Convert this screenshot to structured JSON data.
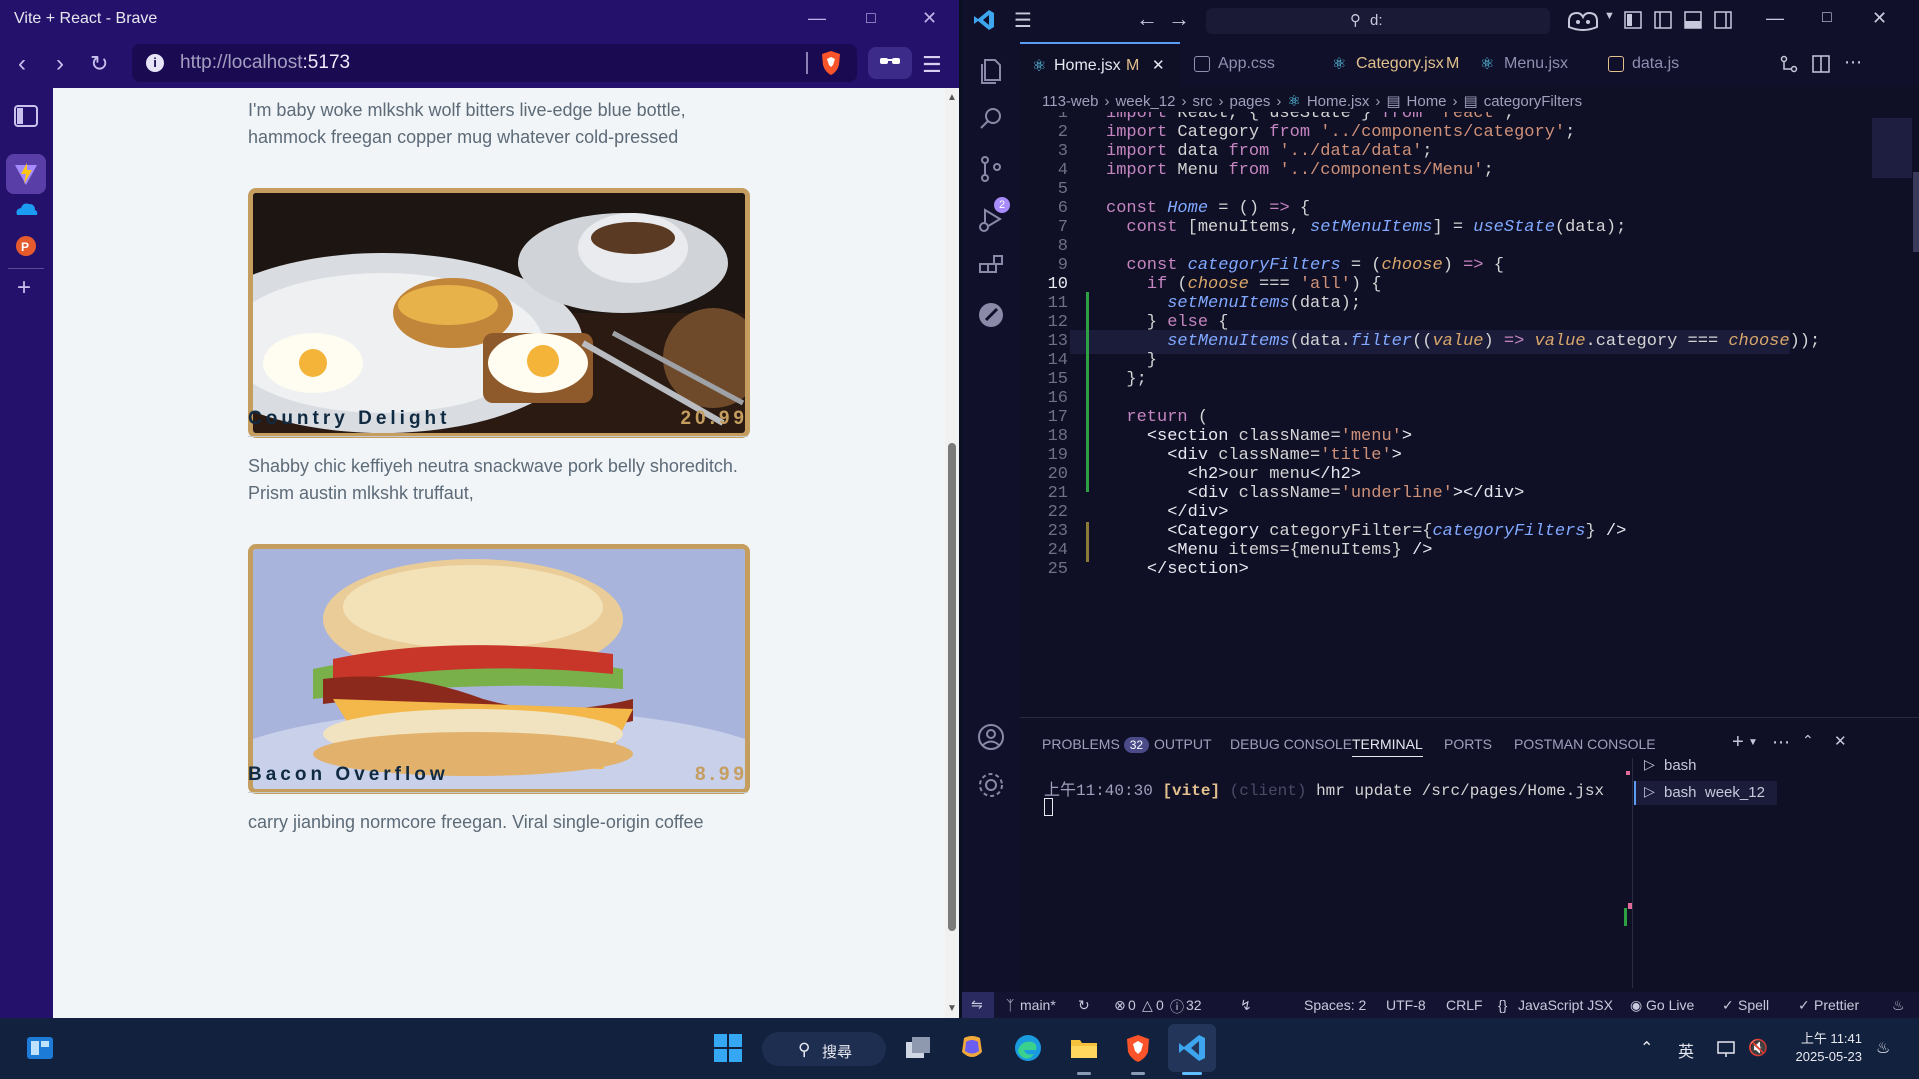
{
  "browser": {
    "window_title": "Vite + React - Brave",
    "url_host": "http://localhost",
    "url_port": ":5173",
    "nav_icons": [
      "back-icon",
      "forward-icon",
      "reload-icon"
    ]
  },
  "menu_page": {
    "intro_desc": "I'm baby woke mlkshk wolf bitters live-edge blue bottle, hammock freegan copper mug whatever cold-pressed",
    "items": [
      {
        "name": "Country Delight",
        "price": "20.99",
        "desc": "Shabby chic keffiyeh neutra snackwave pork belly shoreditch. Prism austin mlkshk truffaut,"
      },
      {
        "name": "Bacon Overflow",
        "price": "8.99",
        "desc": "carry jianbing normcore freegan. Viral single-origin coffee"
      }
    ]
  },
  "vscode": {
    "search_text": "d:",
    "tabs": [
      {
        "label": "Home.jsx",
        "badge": "M",
        "active": true
      },
      {
        "label": "App.css",
        "badge": ""
      },
      {
        "label": "Category.jsx",
        "badge": "M"
      },
      {
        "label": "Menu.jsx",
        "badge": ""
      },
      {
        "label": "data.js",
        "badge": ""
      }
    ],
    "breadcrumb": {
      "p1": "113-web",
      "p2": "week_12",
      "p3": "src",
      "p4": "pages",
      "p5": "Home.jsx",
      "p6": "Home",
      "p7": "categoryFilters"
    },
    "scm_badge": "2",
    "panel": {
      "problems_label": "PROBLEMS",
      "problems_count": "32",
      "tabs": [
        "OUTPUT",
        "DEBUG CONSOLE",
        "TERMINAL",
        "PORTS",
        "POSTMAN CONSOLE"
      ],
      "terminal_time": "上午11:40:30",
      "terminal_tag": "[vite]",
      "terminal_client": "(client)",
      "terminal_msg": "hmr update /src/pages/Home.jsx",
      "shells": [
        "bash",
        "bash  week_12"
      ]
    },
    "status": {
      "branch": "main*",
      "errors": "0",
      "warnings": "0",
      "infos": "32",
      "spaces": "Spaces: 2",
      "encoding": "UTF-8",
      "eol": "CRLF",
      "language": "JavaScript JSX",
      "golive": "Go Live",
      "spell": "Spell",
      "prettier": "Prettier"
    }
  },
  "taskbar": {
    "search_label": "搜尋",
    "ime": "英",
    "time": "上午 11:41",
    "date": "2025-05-23"
  }
}
